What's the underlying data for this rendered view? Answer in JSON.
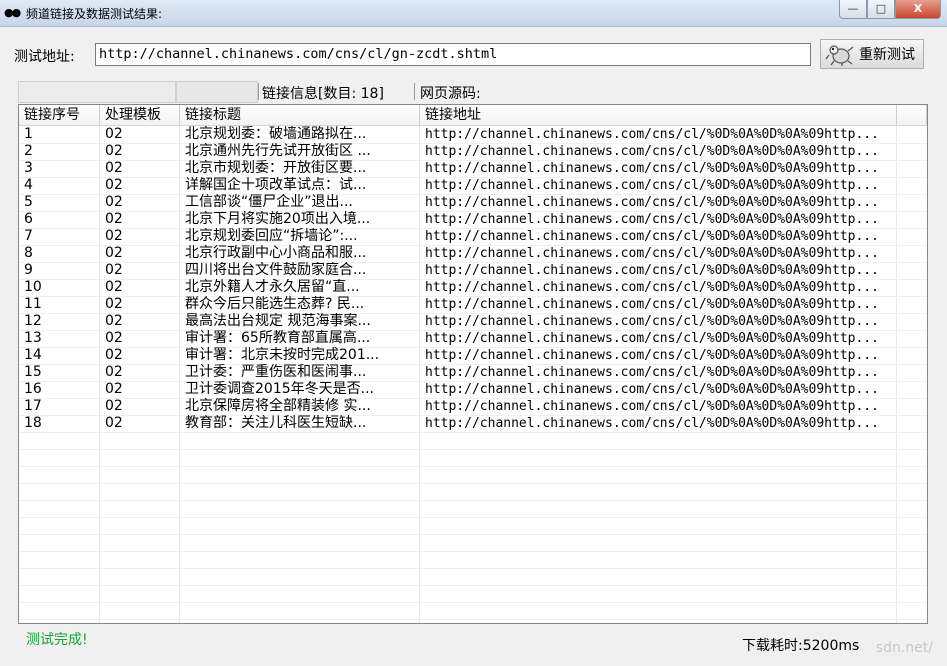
{
  "window": {
    "title": "频道链接及数据测试结果:",
    "icon": "owl-eyes-icon",
    "controls": {
      "minimize": "—",
      "maximize": "□",
      "close": "X"
    }
  },
  "url_bar": {
    "label": "测试地址:",
    "value": "http://channel.chinanews.com/cns/cl/gn-zcdt.shtml",
    "button_label": "重新测试",
    "button_icon": "bug-icon"
  },
  "status_strip": {
    "link_info": "链接信息[数目: 18]",
    "page_source": "网页源码:"
  },
  "table": {
    "columns": [
      "链接序号",
      "处理模板",
      "链接标题",
      "链接地址"
    ],
    "rows": [
      [
        "1",
        "02",
        "北京规划委：破墙通路拟在...",
        "http://channel.chinanews.com/cns/cl/%0D%0A%0D%0A%09http..."
      ],
      [
        "2",
        "02",
        "北京通州先行先试开放街区 ...",
        "http://channel.chinanews.com/cns/cl/%0D%0A%0D%0A%09http..."
      ],
      [
        "3",
        "02",
        "北京市规划委：开放街区要...",
        "http://channel.chinanews.com/cns/cl/%0D%0A%0D%0A%09http..."
      ],
      [
        "4",
        "02",
        "详解国企十项改革试点：试...",
        "http://channel.chinanews.com/cns/cl/%0D%0A%0D%0A%09http..."
      ],
      [
        "5",
        "02",
        "工信部谈“僵尸企业”退出...",
        "http://channel.chinanews.com/cns/cl/%0D%0A%0D%0A%09http..."
      ],
      [
        "6",
        "02",
        "北京下月将实施20项出入境...",
        "http://channel.chinanews.com/cns/cl/%0D%0A%0D%0A%09http..."
      ],
      [
        "7",
        "02",
        "北京规划委回应“拆墙论”:...",
        "http://channel.chinanews.com/cns/cl/%0D%0A%0D%0A%09http..."
      ],
      [
        "8",
        "02",
        "北京行政副中心小商品和服...",
        "http://channel.chinanews.com/cns/cl/%0D%0A%0D%0A%09http..."
      ],
      [
        "9",
        "02",
        "四川将出台文件鼓励家庭合...",
        "http://channel.chinanews.com/cns/cl/%0D%0A%0D%0A%09http..."
      ],
      [
        "10",
        "02",
        "北京外籍人才永久居留“直...",
        "http://channel.chinanews.com/cns/cl/%0D%0A%0D%0A%09http..."
      ],
      [
        "11",
        "02",
        "群众今后只能选生态葬? 民...",
        "http://channel.chinanews.com/cns/cl/%0D%0A%0D%0A%09http..."
      ],
      [
        "12",
        "02",
        "最高法出台规定 规范海事案...",
        "http://channel.chinanews.com/cns/cl/%0D%0A%0D%0A%09http..."
      ],
      [
        "13",
        "02",
        "审计署：65所教育部直属高...",
        "http://channel.chinanews.com/cns/cl/%0D%0A%0D%0A%09http..."
      ],
      [
        "14",
        "02",
        "审计署：北京未按时完成201...",
        "http://channel.chinanews.com/cns/cl/%0D%0A%0D%0A%09http..."
      ],
      [
        "15",
        "02",
        "卫计委：严重伤医和医闹事...",
        "http://channel.chinanews.com/cns/cl/%0D%0A%0D%0A%09http..."
      ],
      [
        "16",
        "02",
        "卫计委调查2015年冬天是否...",
        "http://channel.chinanews.com/cns/cl/%0D%0A%0D%0A%09http..."
      ],
      [
        "17",
        "02",
        "北京保障房将全部精装修 实...",
        "http://channel.chinanews.com/cns/cl/%0D%0A%0D%0A%09http..."
      ],
      [
        "18",
        "02",
        "教育部：关注儿科医生短缺...",
        "http://channel.chinanews.com/cns/cl/%0D%0A%0D%0A%09http..."
      ]
    ]
  },
  "footer": {
    "status": "测试完成!",
    "download_time": "下载耗时:5200ms",
    "watermark": "sdn.net/"
  },
  "colors": {
    "status_ok": "#1e9e3a"
  }
}
